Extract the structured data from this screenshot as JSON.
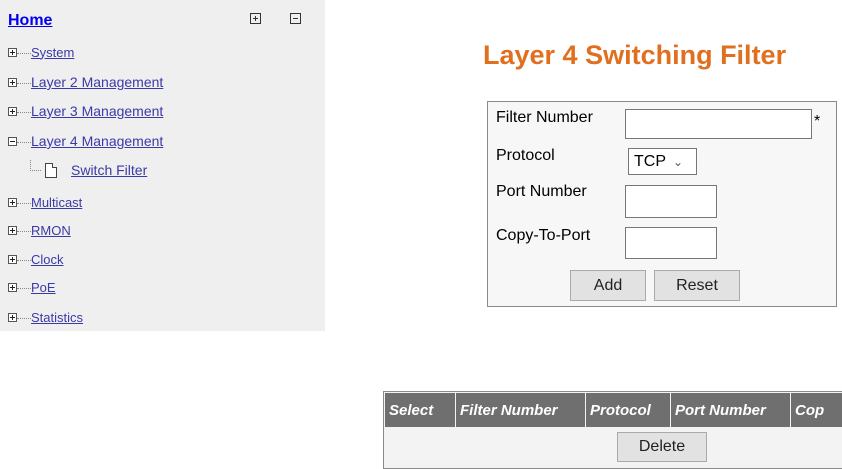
{
  "sidebar": {
    "home": "Home",
    "items": [
      {
        "label": "System",
        "state": "collapsed"
      },
      {
        "label": "Layer 2 Management",
        "state": "collapsed"
      },
      {
        "label": "Layer 3 Management",
        "state": "collapsed"
      },
      {
        "label": "Layer 4 Management",
        "state": "expanded",
        "children": [
          "Switch Filter"
        ]
      },
      {
        "label": "Multicast",
        "state": "collapsed"
      },
      {
        "label": "RMON",
        "state": "collapsed"
      },
      {
        "label": "Clock",
        "state": "collapsed"
      },
      {
        "label": "PoE",
        "state": "collapsed"
      },
      {
        "label": "Statistics",
        "state": "collapsed"
      }
    ]
  },
  "main": {
    "title": "Layer 4 Switching Filter",
    "form": {
      "filter_number_label": "Filter Number",
      "filter_number_value": "",
      "required_mark": "*",
      "protocol_label": "Protocol",
      "protocol_value": "TCP",
      "port_number_label": "Port Number",
      "port_number_value": "",
      "copy_to_port_label": "Copy-To-Port",
      "copy_to_port_value": "",
      "add_label": "Add",
      "reset_label": "Reset"
    },
    "table": {
      "headers": [
        "Select",
        "Filter Number",
        "Protocol",
        "Port Number",
        "Cop"
      ],
      "delete_label": "Delete"
    }
  },
  "colors": {
    "title": "#e07020",
    "header_bg": "#6f6f6f",
    "link": "#3a3aa8",
    "sidebar_bg": "#efefef"
  }
}
